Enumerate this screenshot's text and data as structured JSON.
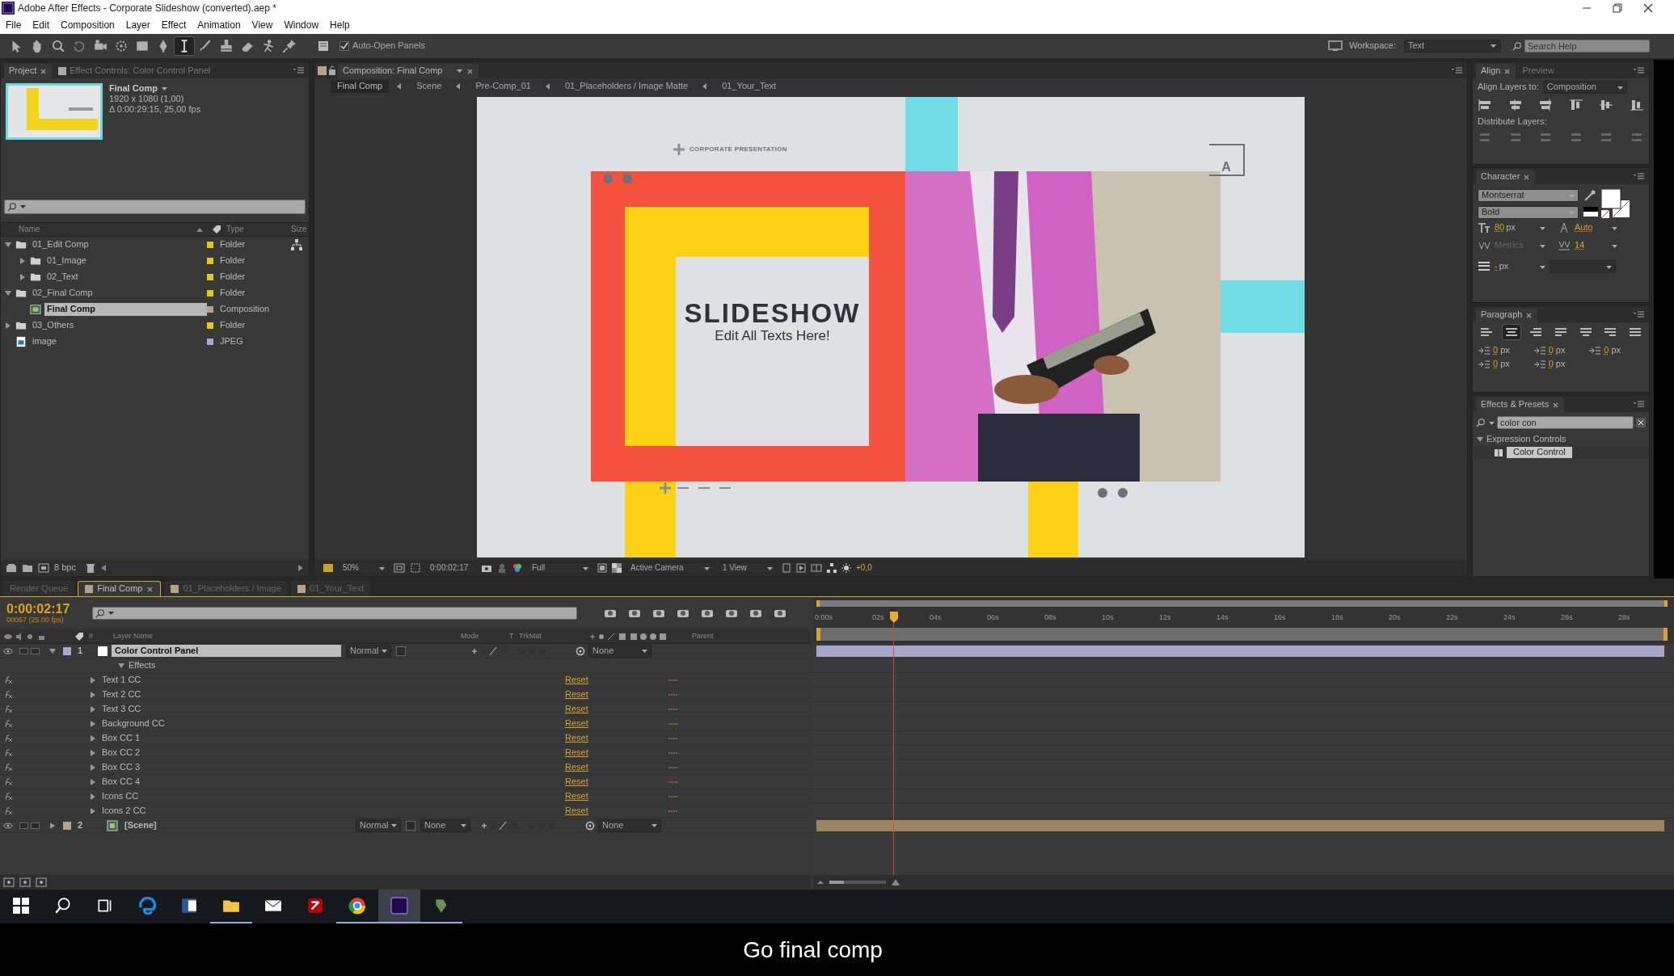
{
  "window": {
    "title": "Adobe After Effects - Corporate Slideshow (converted).aep *"
  },
  "menu": [
    "File",
    "Edit",
    "Composition",
    "Layer",
    "Effect",
    "Animation",
    "View",
    "Window",
    "Help"
  ],
  "toolbar": {
    "tools": [
      {
        "kind": "selection",
        "selected": false
      },
      {
        "kind": "hand",
        "selected": false
      },
      {
        "kind": "zoom",
        "selected": false
      },
      {
        "kind": "rotate",
        "selected": false
      },
      {
        "kind": "camera",
        "selected": false
      },
      {
        "kind": "pan",
        "selected": false
      },
      {
        "kind": "rectangle",
        "selected": false
      },
      {
        "kind": "pen",
        "selected": false
      },
      {
        "kind": "text",
        "selected": true
      },
      {
        "kind": "brush",
        "selected": false
      },
      {
        "kind": "stamp",
        "selected": false
      },
      {
        "kind": "eraser",
        "selected": false
      },
      {
        "kind": "puppet",
        "selected": false
      },
      {
        "kind": "pin",
        "selected": false
      }
    ],
    "auto_open_panels": {
      "label": "Auto-Open Panels",
      "checked": true
    },
    "workspace_label": "Workspace:",
    "workspace": "Text",
    "search_placeholder": "Search Help"
  },
  "project_panel": {
    "tabs": [
      {
        "label": "Project",
        "selected": true
      },
      {
        "label": "Effect Controls: Color Control Panel",
        "selected": false
      }
    ],
    "preview": {
      "name": "Final Comp",
      "size": "1920 x 1080 (1,00)",
      "duration": "Δ 0:00:29:15, 25,00 fps"
    },
    "columns": {
      "name": "Name",
      "type": "Type",
      "size": "Size"
    },
    "items": [
      {
        "name": "01_Edit Comp",
        "kind": "folder",
        "type": "Folder",
        "color": "#e8c619",
        "expanded": true,
        "selected": false,
        "children": [
          {
            "name": "01_Image",
            "kind": "folder",
            "type": "Folder",
            "color": "#e8c619",
            "expanded": false,
            "selected": false
          },
          {
            "name": "02_Text",
            "kind": "folder",
            "type": "Folder",
            "color": "#e8c619",
            "expanded": false,
            "selected": false
          }
        ]
      },
      {
        "name": "02_Final Comp",
        "kind": "folder",
        "type": "Folder",
        "color": "#e8c619",
        "expanded": true,
        "selected": false,
        "children": [
          {
            "name": "Final Comp",
            "kind": "composition",
            "type": "Composition",
            "color": "#b5a48a",
            "selected": true
          }
        ]
      },
      {
        "name": "03_Others",
        "kind": "folder",
        "type": "Folder",
        "color": "#e8c619",
        "expanded": false,
        "selected": false
      },
      {
        "name": "image",
        "kind": "jpeg",
        "type": "JPEG",
        "color": "#a9a6d8",
        "selected": false
      }
    ],
    "bit_depth": "8 bpc"
  },
  "composition_panel": {
    "tab": "Composition: Final Comp",
    "breadcrumbs": [
      {
        "label": "Final Comp",
        "selected": true
      },
      {
        "label": "Scene",
        "selected": false
      },
      {
        "label": "Pre-Comp_01",
        "selected": false
      },
      {
        "label": "01_Placeholders / Image Matte",
        "selected": false
      },
      {
        "label": "01_Your_Text",
        "selected": false
      }
    ],
    "slide": {
      "tag": "CORPORATE PRESENTATION",
      "title": "SLIDESHOW",
      "subtitle": "Edit All Texts Here!",
      "corner_letter": "A"
    },
    "viewer_bar": {
      "zoom": "50%",
      "timecode": "0:00:02:17",
      "resolution": "Full",
      "camera": "Active Camera",
      "view_layout": "1 View",
      "exposure": "+0,0"
    }
  },
  "align_panel": {
    "tabs": [
      {
        "label": "Align",
        "selected": true
      },
      {
        "label": "Preview",
        "selected": false
      }
    ],
    "align_to_label": "Align Layers to:",
    "align_to": "Composition",
    "distribute_label": "Distribute Layers:"
  },
  "character_panel": {
    "title": "Character",
    "font": "Montserrat",
    "style": "Bold",
    "size": "80",
    "size_unit": "px",
    "leading": "Auto",
    "kerning": "Metrics",
    "tracking": "14",
    "stroke_width": "-",
    "stroke_unit": "px"
  },
  "paragraph_panel": {
    "title": "Paragraph",
    "alignments": [
      {
        "kind": "left",
        "selected": false
      },
      {
        "kind": "center",
        "selected": true
      },
      {
        "kind": "right",
        "selected": false
      },
      {
        "kind": "justify-left",
        "selected": false
      },
      {
        "kind": "justify-center",
        "selected": false
      },
      {
        "kind": "justify-right",
        "selected": false
      },
      {
        "kind": "justify-all",
        "selected": false
      }
    ],
    "indents": [
      {
        "value": "0",
        "unit": "px"
      },
      {
        "value": "0",
        "unit": "px"
      },
      {
        "value": "0",
        "unit": "px"
      },
      {
        "value": "0",
        "unit": "px"
      },
      {
        "value": "0",
        "unit": "px"
      }
    ]
  },
  "effects_presets": {
    "title": "Effects & Presets",
    "search": "color con",
    "groups": [
      {
        "name": "Expression Controls",
        "expanded": true,
        "children": [
          {
            "name": "Color Control",
            "selected": true
          }
        ]
      }
    ]
  },
  "timeline": {
    "tabs": [
      {
        "label": "Render Queue",
        "selected": false
      },
      {
        "label": "Final Comp",
        "selected": true
      },
      {
        "label": "01_Placeholders / Image",
        "selected": false
      },
      {
        "label": "01_Your_Text",
        "selected": false
      }
    ],
    "timecode": "0:00:02:17",
    "frame_info": "00067 (25.00 fps)",
    "columns": {
      "number": "#",
      "layer_name": "Layer Name",
      "mode": "Mode",
      "t": "T",
      "trkmat": "TrkMat",
      "parent": "Parent"
    },
    "layers": [
      {
        "number": "1",
        "name": "Color Control Panel",
        "kind": "solid",
        "color": "#a9a6d8",
        "expanded": true,
        "selected": true,
        "mode": "Normal",
        "preserve_transparency": false,
        "parent": "None",
        "effects_label": "Effects",
        "effects": [
          {
            "name": "Text 1 CC",
            "reset": "Reset"
          },
          {
            "name": "Text 2 CC",
            "reset": "Reset"
          },
          {
            "name": "Text 3 CC",
            "reset": "Reset"
          },
          {
            "name": "Background CC",
            "reset": "Reset"
          },
          {
            "name": "Box CC 1",
            "reset": "Reset"
          },
          {
            "name": "Box CC 2",
            "reset": "Reset"
          },
          {
            "name": "Box CC 3",
            "reset": "Reset"
          },
          {
            "name": "Box CC 4",
            "reset": "Reset"
          },
          {
            "name": "Icons CC",
            "reset": "Reset"
          },
          {
            "name": "Icons 2 CC",
            "reset": "Reset"
          }
        ]
      },
      {
        "number": "2",
        "name": "[Scene]",
        "kind": "precomp",
        "color": "#b5a48a",
        "expanded": false,
        "selected": false,
        "mode": "Normal",
        "preserve_transparency": false,
        "trkmat": "None",
        "parent": "None"
      }
    ],
    "ruler": [
      "0:00s",
      "02s",
      "04s",
      "06s",
      "08s",
      "10s",
      "12s",
      "14s",
      "16s",
      "18s",
      "20s",
      "22s",
      "24s",
      "26s",
      "28s"
    ],
    "current_time": {
      "level": 0.089
    },
    "zoom_slider": {
      "level": 0.25
    }
  },
  "taskbar": {
    "apps": [
      {
        "kind": "start",
        "running": false,
        "active": false
      },
      {
        "kind": "search",
        "running": false,
        "active": false
      },
      {
        "kind": "taskview",
        "running": false,
        "active": false
      },
      {
        "kind": "edge",
        "running": false,
        "active": false
      },
      {
        "kind": "word",
        "running": false,
        "active": false
      },
      {
        "kind": "explorer",
        "running": true,
        "active": false
      },
      {
        "kind": "mail",
        "running": false,
        "active": false
      },
      {
        "kind": "filezilla",
        "running": false,
        "active": false
      },
      {
        "kind": "chrome",
        "running": true,
        "active": false
      },
      {
        "kind": "aftereffects",
        "running": true,
        "active": true
      },
      {
        "kind": "tool",
        "running": true,
        "active": false
      }
    ]
  },
  "subtitle": "Go final comp"
}
